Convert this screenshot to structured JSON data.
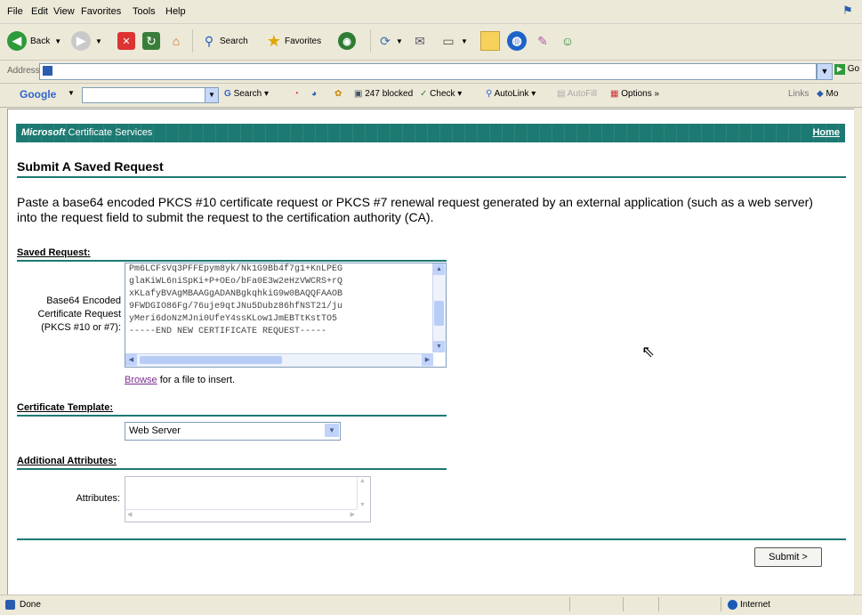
{
  "menu": [
    "File",
    "Edit",
    "View",
    "Favorites",
    "Tools",
    "Help"
  ],
  "toolbar": {
    "back": "Back",
    "search": "Search",
    "favorites": "Favorites"
  },
  "address": {
    "label": "Address",
    "value": "",
    "go": "Go"
  },
  "googlebar": {
    "logo": "Google",
    "search": "Search",
    "blocked": "247 blocked",
    "check": "Check",
    "autolink": "AutoLink",
    "autofill": "AutoFill",
    "options": "Options",
    "links": "Links",
    "more": "Mo"
  },
  "banner": {
    "title_brand": "Microsoft",
    "title_rest": " Certificate Services",
    "home_link": "Home"
  },
  "page": {
    "heading": "Submit A Saved Request",
    "intro": "Paste a base64 encoded PKCS #10 certificate request or PKCS #7 renewal request generated by an external application (such as a web server) into the request field to submit the request to the certification authority (CA).",
    "saved_request_section": "Saved Request:",
    "base64_label": "Base64 Encoded Certificate Request (PKCS #10 or #7):",
    "request_lines": [
      "Pm6LCFsVq3PFFEpym8yk/Nk1G9Bb4f7g1+KnLPEG",
      "glaKiWL6niSpKi+P+OEo/bFa0E3w2eHzVWCRS+rQ",
      "xKLafyBVAgMBAAGgADANBgkqhkiG9w0BAQQFAAOB",
      "9FWDGIO86Fg/76uje9qtJNu5Dubz86hfNST21/ju",
      "yMeri6doNzMJni0UfeY4ssKLow1JmEBTtKstTO5",
      "-----END NEW CERTIFICATE REQUEST-----"
    ],
    "browse_link": "Browse",
    "browse_rest": " for a file to insert.",
    "template_section": "Certificate Template:",
    "template_value": "Web Server",
    "attributes_section": "Additional Attributes:",
    "attributes_label": "Attributes:",
    "attributes_value": "",
    "submit": "Submit >"
  },
  "status": {
    "text": "Done",
    "zone": "Internet"
  },
  "colors": {
    "banner": "#1d7a72",
    "chrome": "#ece9d8",
    "link_visited": "#7d2f91"
  }
}
